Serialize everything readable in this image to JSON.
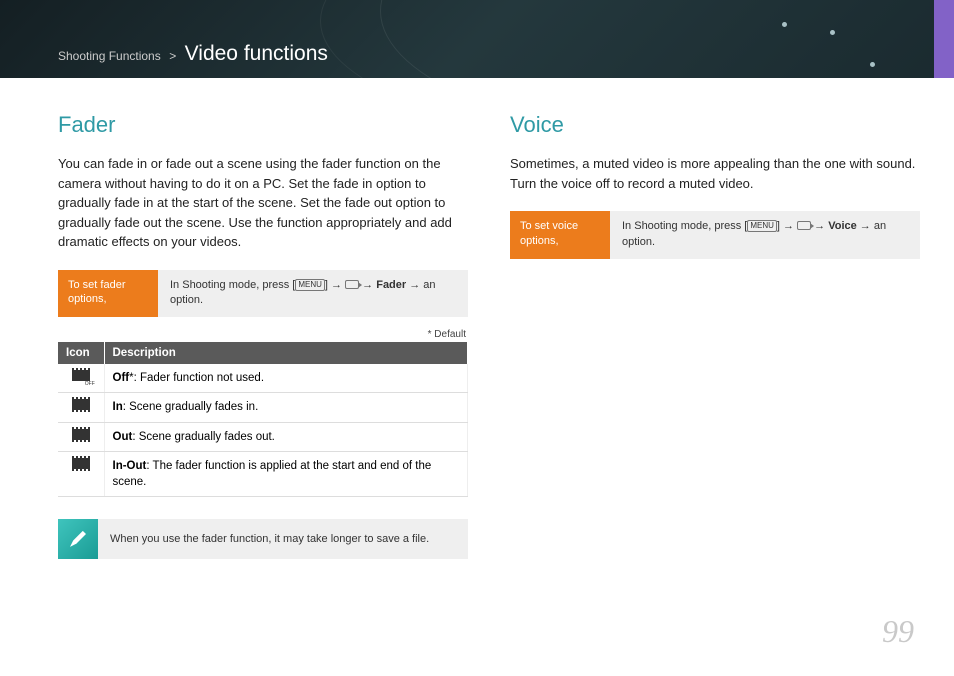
{
  "breadcrumb": {
    "parent": "Shooting Functions",
    "sep": ">",
    "title": "Video functions"
  },
  "fader": {
    "heading": "Fader",
    "intro": "You can fade in or fade out a scene using the fader function on the camera without having to do it on a PC. Set the fade in option to gradually fade in at the start of the scene. Set the fade out option to gradually fade out the scene. Use the function appropriately and add dramatic effects on your videos.",
    "box_label": "To set fader options,",
    "instr_pre": "In Shooting mode, press [",
    "instr_menu": "MENU",
    "instr_mid1": "] → ",
    "instr_mid2": " → ",
    "instr_bold": "Fader",
    "instr_post": " → an option.",
    "default_note": "* Default",
    "th_icon": "Icon",
    "th_desc": "Description",
    "rows": [
      {
        "k": "Off",
        "star": "*",
        "t": ": Fader function not used."
      },
      {
        "k": "In",
        "star": "",
        "t": ": Scene gradually fades in."
      },
      {
        "k": "Out",
        "star": "",
        "t": ": Scene gradually fades out."
      },
      {
        "k": "In-Out",
        "star": "",
        "t": ": The fader function is applied at the start and end of the scene."
      }
    ],
    "note": "When you use the fader function, it may take longer to save a file."
  },
  "voice": {
    "heading": "Voice",
    "intro": "Sometimes, a muted video is more appealing than the one with sound. Turn the voice off to record a muted video.",
    "box_label": "To set voice options,",
    "instr_pre": "In Shooting mode, press [",
    "instr_menu": "MENU",
    "instr_mid1": "] → ",
    "instr_mid2": " → ",
    "instr_bold": "Voice",
    "instr_post": " → an option."
  },
  "page_number": "99"
}
